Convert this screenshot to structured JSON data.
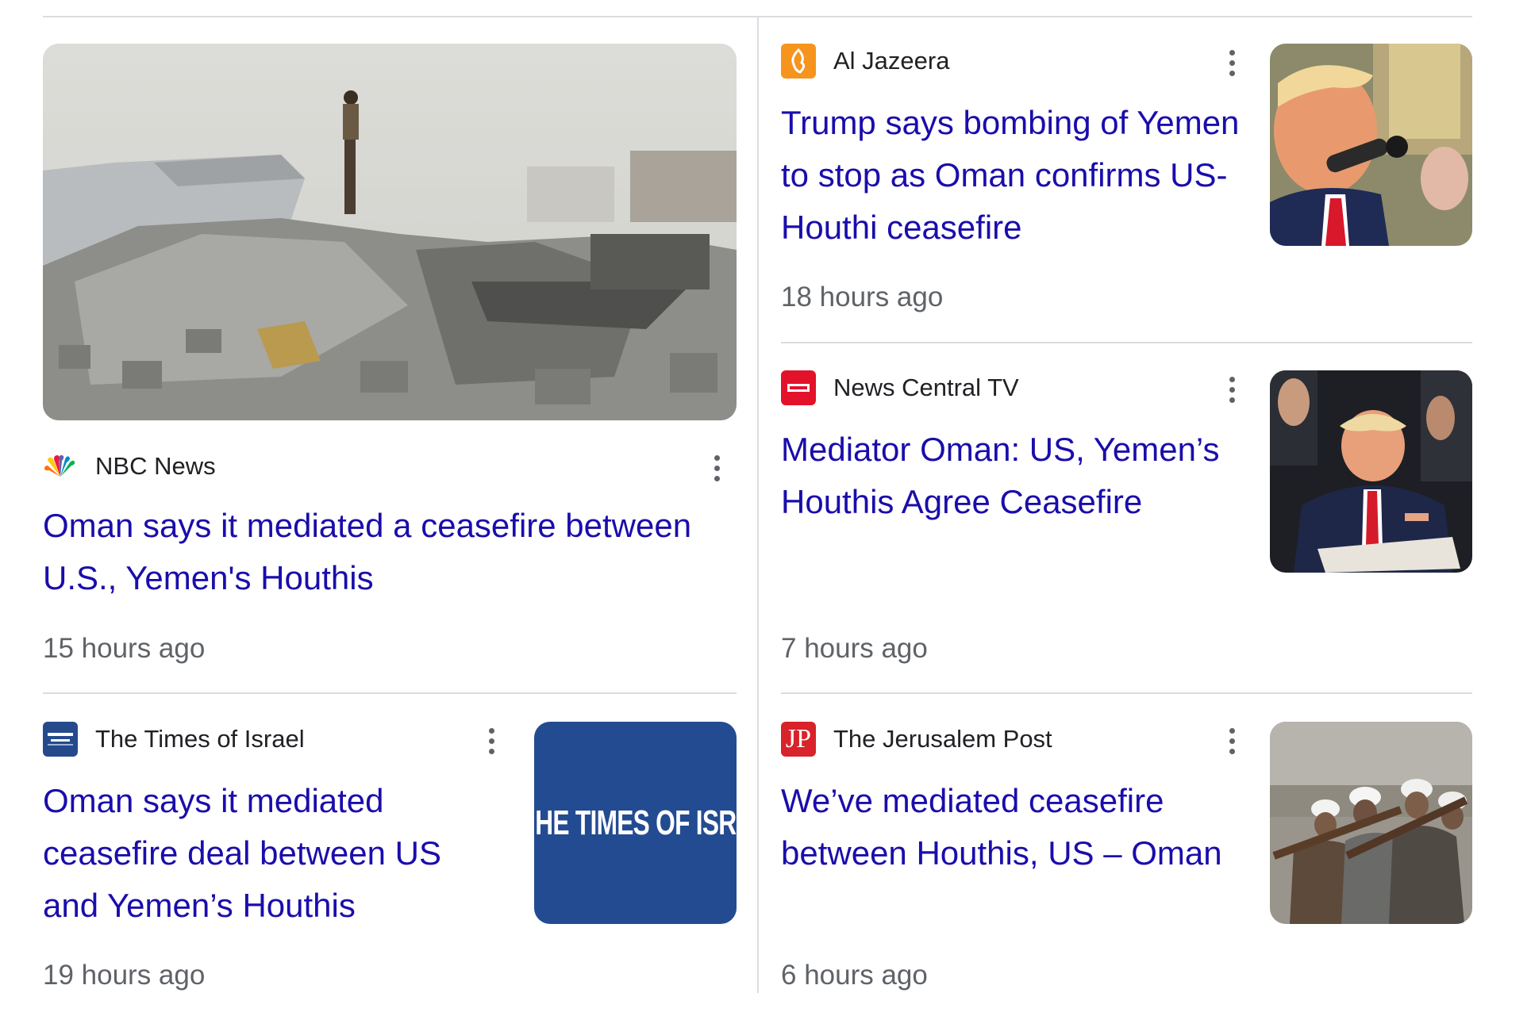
{
  "articles": [
    {
      "source": "NBC News",
      "favicon": "nbc-peacock-icon",
      "headline": "Oman says it mediated a ceasefire between U.S., Yemen's Houthis",
      "time": "15 hours ago"
    },
    {
      "source": "Al Jazeera",
      "favicon": "al-jazeera-logo-icon",
      "headline": "Trump says bombing of Yemen to stop as Oman confirms US-Houthi ceasefire",
      "time": "18 hours ago"
    },
    {
      "source": "News Central TV",
      "favicon": "news-central-logo-icon",
      "headline": "Mediator Oman: US, Yemen’s Houthis Agree Ceasefire",
      "time": "7 hours ago"
    },
    {
      "source": "The Times of Israel",
      "favicon": "times-of-israel-logo-icon",
      "headline": "Oman says it mediated ceasefire deal between US and Yemen’s Houthis",
      "time": "19 hours ago",
      "thumbnail_text": "HE TIMES OF ISR"
    },
    {
      "source": "The Jerusalem Post",
      "favicon": "jerusalem-post-logo-icon",
      "favicon_text": "JP",
      "headline": "We’ve mediated ceasefire between Houthis, US – Oman",
      "time": "6 hours ago"
    }
  ],
  "colors": {
    "link": "#1a0dab",
    "source_text": "#202124",
    "meta_text": "#5f6368",
    "divider": "#dadce0"
  }
}
